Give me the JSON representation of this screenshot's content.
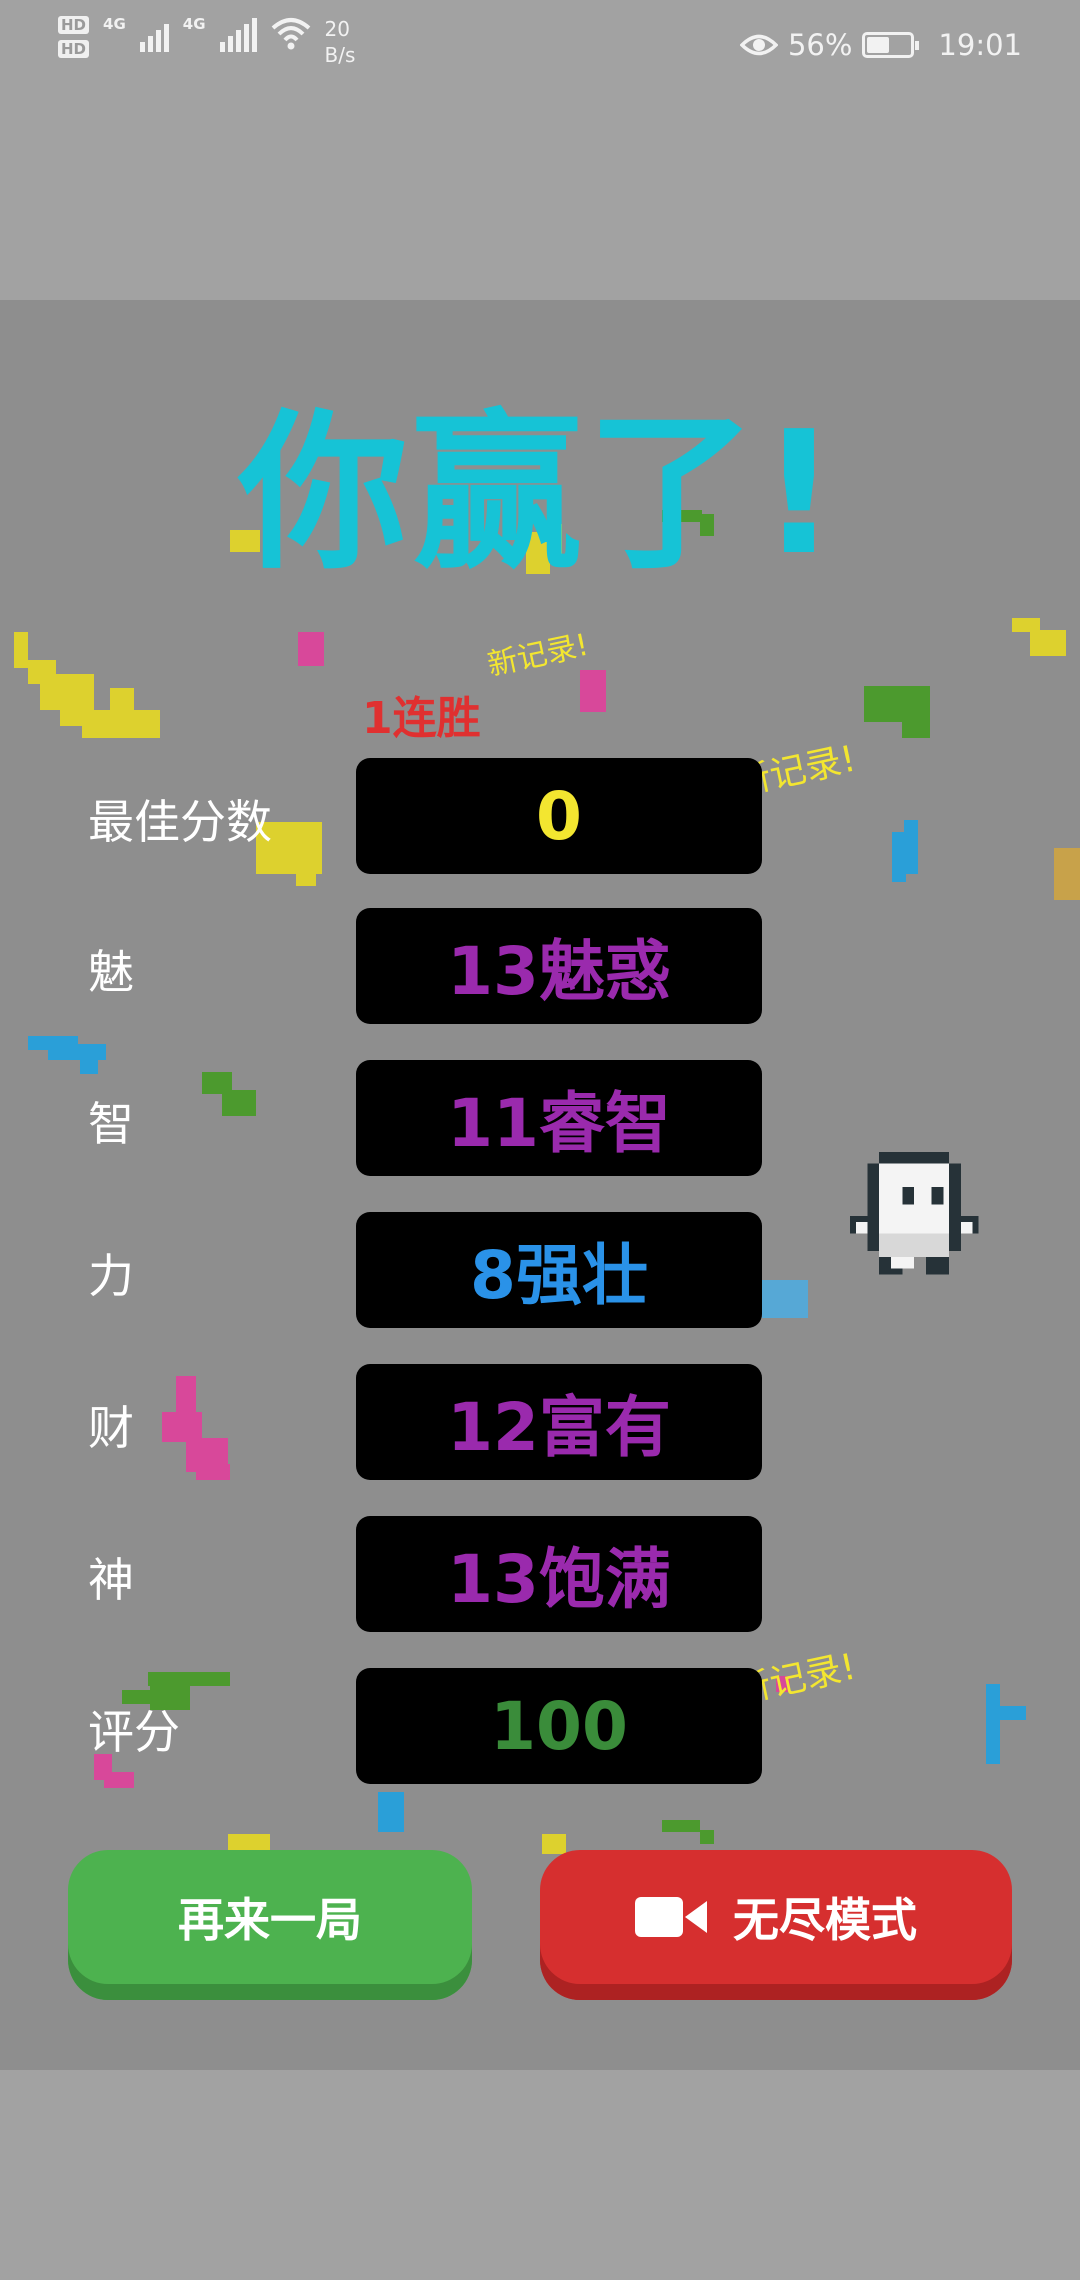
{
  "status_bar": {
    "hd1": "HD",
    "hd2": "HD",
    "net1": "4G",
    "net2": "4G",
    "speed_value": "20",
    "speed_unit": "B/s",
    "battery_percent": "56%",
    "time": "19:01",
    "battery_level": 0.56
  },
  "game": {
    "title": "你赢了!",
    "streak": "1连胜",
    "new_record_1": "新记录!",
    "new_record_2": "新记录!",
    "new_record_3": "新记录!",
    "rows": [
      {
        "label": "最佳分数",
        "value": "0",
        "color": "#f3e630"
      },
      {
        "label": "魅",
        "value": "13魅惑",
        "color": "#9a2aad"
      },
      {
        "label": "智",
        "value": "11睿智",
        "color": "#9a2aad"
      },
      {
        "label": "力",
        "value": "8强壮",
        "color": "#2a92e8"
      },
      {
        "label": "财",
        "value": "12富有",
        "color": "#9a2aad"
      },
      {
        "label": "神",
        "value": "13饱满",
        "color": "#9a2aad"
      },
      {
        "label": "评分",
        "value": "100",
        "color": "#3a8c3a"
      }
    ],
    "buttons": {
      "replay": "再来一局",
      "endless": "无尽模式"
    }
  },
  "colors": {
    "title": "#16c3d6",
    "panel_bg": "#8e8e8e",
    "green_button": "#4db24f",
    "red_button": "#d62f2f"
  },
  "icons": [
    "eye-icon",
    "battery-icon",
    "wifi-icon",
    "signal-icon",
    "video-camera-icon"
  ]
}
